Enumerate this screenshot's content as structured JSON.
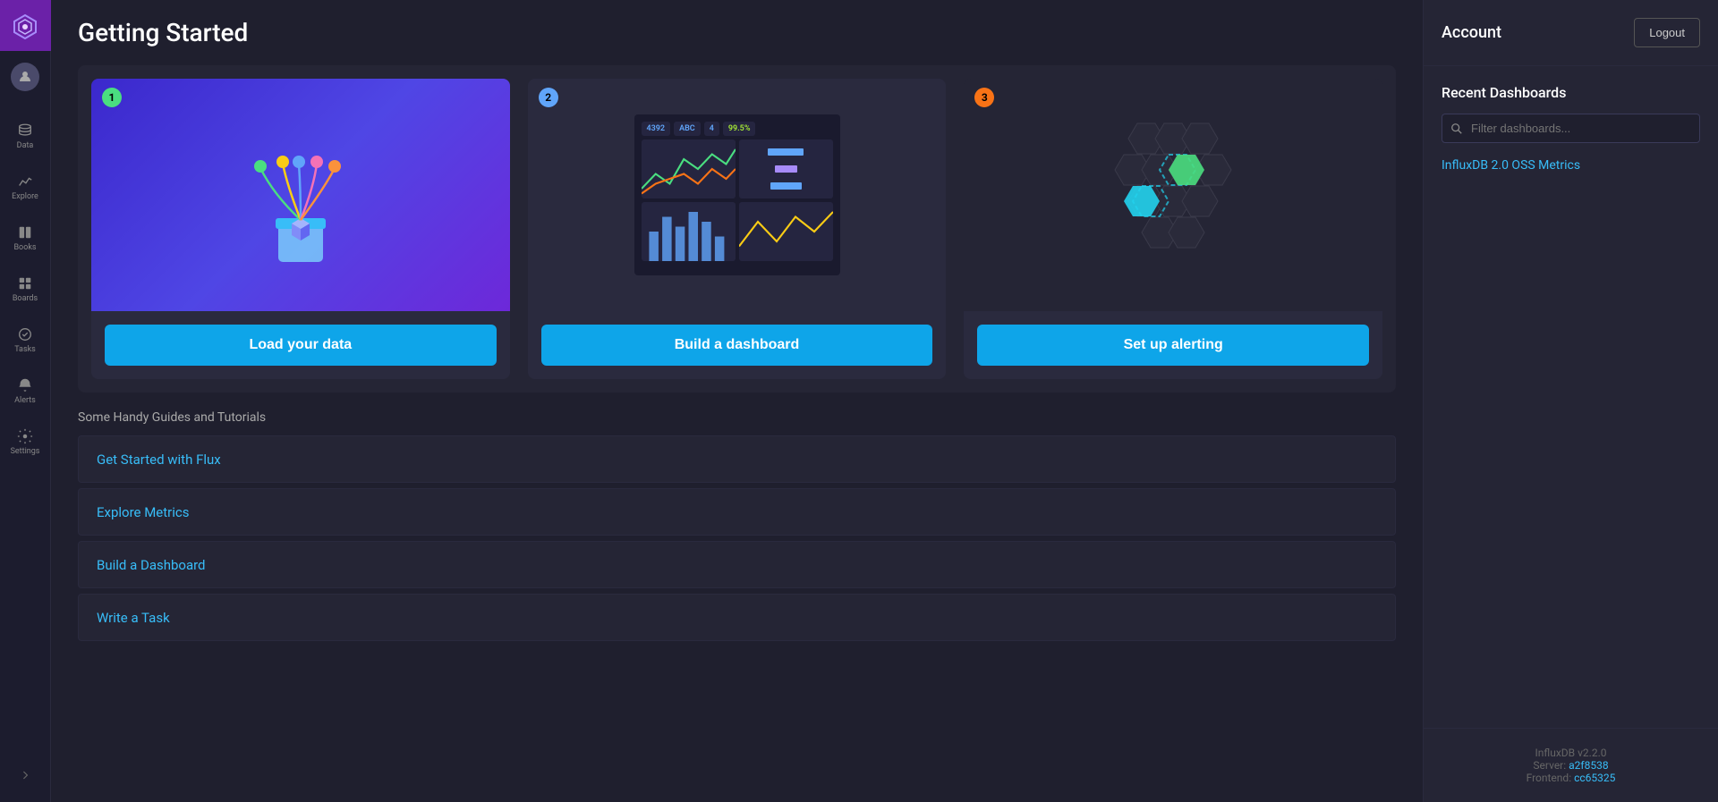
{
  "app": {
    "title": "Getting Started"
  },
  "sidebar": {
    "logo_alt": "InfluxDB Logo",
    "items": [
      {
        "id": "data",
        "label": "Data",
        "icon": "database-icon"
      },
      {
        "id": "explore",
        "label": "Explore",
        "icon": "explore-icon"
      },
      {
        "id": "books",
        "label": "Books",
        "icon": "books-icon"
      },
      {
        "id": "boards",
        "label": "Boards",
        "icon": "boards-icon"
      },
      {
        "id": "tasks",
        "label": "Tasks",
        "icon": "tasks-icon"
      },
      {
        "id": "alerts",
        "label": "Alerts",
        "icon": "alerts-icon"
      },
      {
        "id": "settings",
        "label": "Settings",
        "icon": "settings-icon"
      }
    ],
    "expand_icon": "expand-icon"
  },
  "cards": [
    {
      "id": "load-data",
      "number": "1",
      "button_label": "Load your data"
    },
    {
      "id": "build-dashboard",
      "number": "2",
      "button_label": "Build a dashboard",
      "stats": [
        "4392",
        "ABC",
        "4",
        "99.5%"
      ]
    },
    {
      "id": "set-up-alerting",
      "number": "3",
      "button_label": "Set up alerting"
    }
  ],
  "guides": {
    "title": "Some Handy Guides and Tutorials",
    "items": [
      {
        "id": "flux",
        "label": "Get Started with Flux"
      },
      {
        "id": "metrics",
        "label": "Explore Metrics"
      },
      {
        "id": "dashboard",
        "label": "Build a Dashboard"
      },
      {
        "id": "task",
        "label": "Write a Task"
      }
    ]
  },
  "right_panel": {
    "account_title": "Account",
    "logout_label": "Logout",
    "recent_dashboards_title": "Recent Dashboards",
    "filter_placeholder": "Filter dashboards...",
    "recent_items": [
      {
        "id": "influxdb-oss",
        "label": "InfluxDB 2.0 OSS Metrics"
      }
    ],
    "footer": {
      "version": "InfluxDB v2.2.0",
      "server_label": "Server:",
      "server_hash": "a2f8538",
      "frontend_label": "Frontend:",
      "frontend_hash": "cc65325"
    }
  }
}
